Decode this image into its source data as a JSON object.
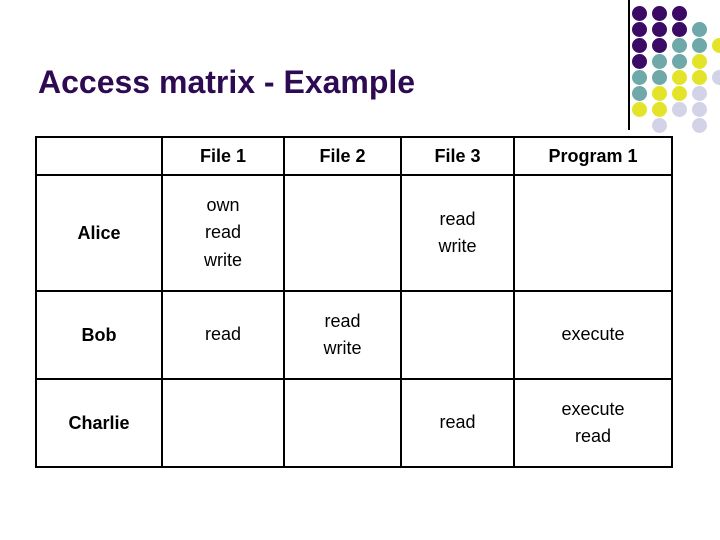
{
  "slide": {
    "title": "Access matrix - Example",
    "title_color": "#2d0a52",
    "background_color": "#ffffff"
  },
  "decoration": {
    "name": "dot-grid-motif",
    "rule_color": "#000000",
    "palette": {
      "purple": "#3b0a64",
      "teal": "#6fa8a8",
      "yellow": "#e3e329",
      "lavender": "#d3d3e8"
    },
    "dots": [
      {
        "row": 0,
        "col": 0,
        "color": "purple"
      },
      {
        "row": 0,
        "col": 1,
        "color": "purple"
      },
      {
        "row": 0,
        "col": 2,
        "color": "purple"
      },
      {
        "row": 1,
        "col": 0,
        "color": "purple"
      },
      {
        "row": 1,
        "col": 1,
        "color": "purple"
      },
      {
        "row": 1,
        "col": 2,
        "color": "purple"
      },
      {
        "row": 1,
        "col": 3,
        "color": "teal"
      },
      {
        "row": 2,
        "col": 0,
        "color": "purple"
      },
      {
        "row": 2,
        "col": 1,
        "color": "purple"
      },
      {
        "row": 2,
        "col": 2,
        "color": "teal"
      },
      {
        "row": 2,
        "col": 3,
        "color": "teal"
      },
      {
        "row": 2,
        "col": 4,
        "color": "yellow"
      },
      {
        "row": 3,
        "col": 0,
        "color": "purple"
      },
      {
        "row": 3,
        "col": 1,
        "color": "teal"
      },
      {
        "row": 3,
        "col": 2,
        "color": "teal"
      },
      {
        "row": 3,
        "col": 3,
        "color": "yellow"
      },
      {
        "row": 4,
        "col": 0,
        "color": "teal"
      },
      {
        "row": 4,
        "col": 1,
        "color": "teal"
      },
      {
        "row": 4,
        "col": 2,
        "color": "yellow"
      },
      {
        "row": 4,
        "col": 3,
        "color": "yellow"
      },
      {
        "row": 4,
        "col": 4,
        "color": "lavender"
      },
      {
        "row": 5,
        "col": 0,
        "color": "teal"
      },
      {
        "row": 5,
        "col": 1,
        "color": "yellow"
      },
      {
        "row": 5,
        "col": 2,
        "color": "yellow"
      },
      {
        "row": 5,
        "col": 3,
        "color": "lavender"
      },
      {
        "row": 6,
        "col": 0,
        "color": "yellow"
      },
      {
        "row": 6,
        "col": 1,
        "color": "yellow"
      },
      {
        "row": 6,
        "col": 2,
        "color": "lavender"
      },
      {
        "row": 6,
        "col": 3,
        "color": "lavender"
      },
      {
        "row": 7,
        "col": 1,
        "color": "lavender"
      },
      {
        "row": 7,
        "col": 3,
        "color": "lavender"
      }
    ]
  },
  "matrix": {
    "columns": [
      "",
      "File 1",
      "File 2",
      "File 3",
      "Program 1"
    ],
    "rows": [
      {
        "subject": "Alice",
        "cells": [
          [
            "own",
            "read",
            "write"
          ],
          [],
          [
            "read",
            "write"
          ],
          []
        ]
      },
      {
        "subject": "Bob",
        "cells": [
          [
            "read"
          ],
          [
            "read",
            "write"
          ],
          [],
          [
            "execute"
          ]
        ]
      },
      {
        "subject": "Charlie",
        "cells": [
          [],
          [],
          [
            "read"
          ],
          [
            "execute",
            "read"
          ]
        ]
      }
    ]
  }
}
